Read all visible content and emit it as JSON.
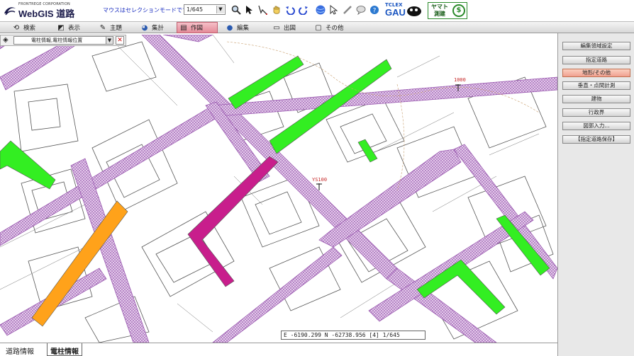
{
  "header": {
    "logo_small": "FRONTREGE CORPORATION",
    "logo_text": "WebGIS 道路",
    "mode_text": "マウスはセレクションモードです",
    "scale": "1/645",
    "brand1_top": "TCLEX",
    "brand1_main": "GAU",
    "brand2_text": "ヤマト測建"
  },
  "toolbar_icons": [
    "zoom-icon",
    "select-arrow-icon",
    "draw-line-icon",
    "pan-hand-icon",
    "undo-icon",
    "redo-icon",
    "globe-icon",
    "pointer-icon",
    "measure-icon",
    "tooltip-icon",
    "info-icon"
  ],
  "tabs": [
    {
      "label": "検索",
      "icon": "search-icon"
    },
    {
      "label": "表示",
      "icon": "display-icon"
    },
    {
      "label": "主題",
      "icon": "theme-icon"
    },
    {
      "label": "集計",
      "icon": "aggregate-icon"
    },
    {
      "label": "作図",
      "icon": "draw-icon"
    },
    {
      "label": "編集",
      "icon": "edit-icon"
    },
    {
      "label": "出図",
      "icon": "print-icon"
    },
    {
      "label": "その他",
      "icon": "other-icon"
    }
  ],
  "active_tab": "作図",
  "layer": {
    "selected": "電柱情報,電柱情報位置"
  },
  "panel": {
    "buttons": [
      "編集領域設定",
      "指定道路",
      "地形/その他",
      "垂直・点間計測",
      "建物",
      "行政界",
      "図郭入力...",
      "【指定道路保存】"
    ]
  },
  "map": {
    "labels": [
      {
        "text": "1000"
      },
      {
        "text": "YS100"
      }
    ],
    "coord": "E -6190.299 N -62738.956 [4] 1/645"
  },
  "bottom_tabs": [
    "道路情報",
    "電柱情報"
  ],
  "colors": {
    "road": "#d6aee0",
    "highlight_green": "#33ee22",
    "highlight_orange": "#ffa21a",
    "highlight_magenta": "#c81e8c",
    "active_tab": "#e48a98"
  }
}
